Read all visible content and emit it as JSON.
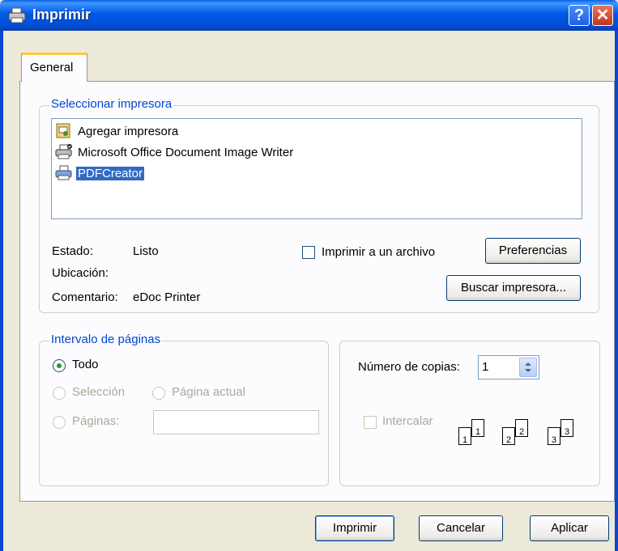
{
  "window": {
    "title": "Imprimir",
    "help_glyph": "?",
    "close_glyph": "✕"
  },
  "tab": {
    "label": "General"
  },
  "printer_group": {
    "legend": "Seleccionar impresora",
    "printers": [
      {
        "name": "Agregar impresora",
        "icon": "add-printer-icon"
      },
      {
        "name": "Microsoft Office Document Image Writer",
        "icon": "printer-default-icon"
      },
      {
        "name": "PDFCreator",
        "icon": "printer-icon",
        "selected": true
      }
    ],
    "status_label": "Estado:",
    "status_value": "Listo",
    "location_label": "Ubicación:",
    "location_value": "",
    "comment_label": "Comentario:",
    "comment_value": "eDoc Printer",
    "print_to_file_label": "Imprimir a un archivo",
    "preferences_label": "Preferencias",
    "find_printer_label": "Buscar impresora..."
  },
  "range_group": {
    "legend": "Intervalo de páginas",
    "all_label": "Todo",
    "selection_label": "Selección",
    "current_page_label": "Página actual",
    "pages_label": "Páginas:",
    "pages_value": ""
  },
  "copies_group": {
    "copies_label": "Número de copias:",
    "copies_value": "1",
    "collate_label": "Intercalar",
    "collate_pages": [
      "1",
      "1",
      "2",
      "2",
      "3",
      "3"
    ]
  },
  "buttons": {
    "print": "Imprimir",
    "cancel": "Cancelar",
    "apply": "Aplicar"
  }
}
